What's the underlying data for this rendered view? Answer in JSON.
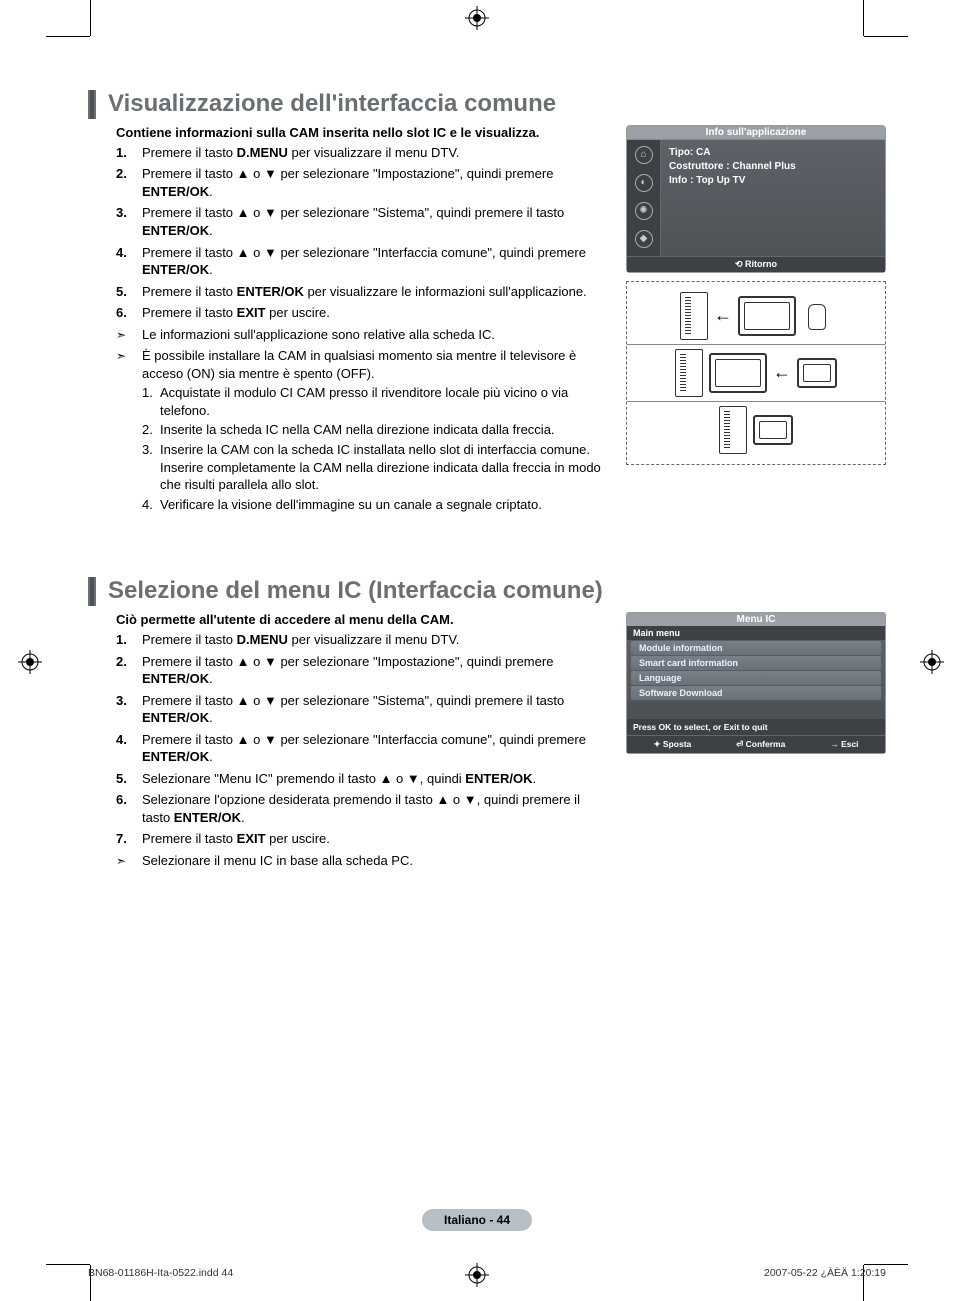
{
  "section1": {
    "title": "Visualizzazione dell'interfaccia comune",
    "intro": "Contiene informazioni sulla CAM inserita nello slot IC e le visualizza.",
    "steps": [
      "Premere il tasto <b>D.MENU</b> per visualizzare il menu DTV.",
      "Premere il tasto ▲ o ▼ per selezionare \"Impostazione\", quindi premere <b>ENTER/OK</b>.",
      "Premere il tasto ▲ o ▼ per selezionare \"Sistema\", quindi premere il tasto <b>ENTER/OK</b>.",
      "Premere il tasto ▲ o ▼ per selezionare \"Interfaccia comune\", quindi premere <b>ENTER/OK</b>.",
      "Premere il tasto <b>ENTER/OK</b> per visualizzare le informazioni sull'applicazione.",
      "Premere il tasto <b>EXIT</b> per uscire."
    ],
    "notes": [
      "Le informazioni sull'applicazione sono relative alla scheda IC.",
      "È possibile installare la CAM in qualsiasi momento sia mentre il televisore è acceso (ON) sia mentre è spento (OFF)."
    ],
    "substeps": [
      "Acquistate il modulo CI CAM presso il rivenditore locale più vicino o via telefono.",
      "Inserite la scheda IC nella CAM nella direzione indicata dalla freccia.",
      "Inserire la CAM con la scheda IC installata nello slot di interfaccia comune. Inserire completamente la CAM nella direzione indicata dalla freccia in modo che risulti parallela allo slot.",
      "Verificare la visione dell'immagine su un canale a segnale criptato."
    ],
    "osd": {
      "title": "Info sull'applicazione",
      "line1": "Tipo: CA",
      "line2": "Costruttore : Channel Plus",
      "line3": "Info : Top Up TV",
      "return": "Ritorno"
    }
  },
  "section2": {
    "title": "Selezione del menu IC (Interfaccia comune)",
    "intro": "Ciò permette all'utente di accedere al menu della CAM.",
    "steps": [
      "Premere il tasto <b>D.MENU</b> per visualizzare il menu DTV.",
      "Premere il tasto ▲ o ▼ per selezionare \"Impostazione\", quindi premere <b>ENTER/OK</b>.",
      "Premere il tasto ▲ o ▼ per selezionare \"Sistema\", quindi premere il tasto <b>ENTER/OK</b>.",
      "Premere il tasto ▲ o ▼ per selezionare \"Interfaccia comune\", quindi premere <b>ENTER/OK</b>.",
      "Selezionare \"Menu IC\" premendo il tasto ▲ o ▼, quindi <b>ENTER/OK</b>.",
      "Selezionare l'opzione desiderata premendo il tasto ▲ o ▼, quindi premere il tasto <b>ENTER/OK</b>.",
      "Premere il tasto <b>EXIT</b> per uscire."
    ],
    "notes": [
      "Selezionare il menu IC in base alla scheda PC."
    ],
    "osd": {
      "title": "Menu IC",
      "sub": "Main menu",
      "items": [
        "Module information",
        "Smart card information",
        "Language",
        "Software Download"
      ],
      "hint": "Press OK to select, or Exit to quit",
      "foot": [
        "Sposta",
        "Conferma",
        "Esci"
      ]
    }
  },
  "footer": {
    "page": "Italiano - 44"
  },
  "meta": {
    "left": "BN68-01186H-Ita-0522.indd   44",
    "right": "2007-05-22   ¿ÀÈÄ 1:20:19"
  }
}
